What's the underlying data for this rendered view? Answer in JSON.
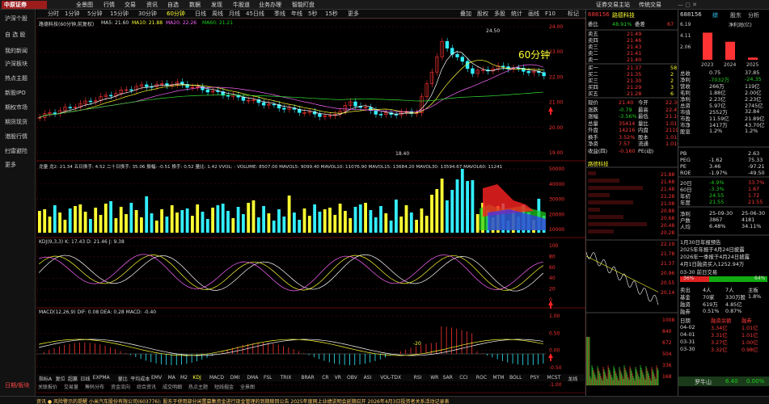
{
  "app": {
    "logo": "中原证券",
    "top_menu": [
      "全景图",
      "行情",
      "交易",
      "资讯",
      "自选",
      "数据",
      "发现",
      "牛股道",
      "业务办理",
      "智能盯盘"
    ],
    "top_right": [
      "证券交易主站",
      "传统交易"
    ]
  },
  "sidebar": [
    "沪深个股",
    "自 选 股",
    "我的新闻",
    "沪深板块",
    "热点主题",
    "新股IPO",
    "期权市场",
    "期货现货",
    "港股行情",
    "扫雷避险",
    "更多",
    "日期/板块"
  ],
  "tabs": [
    "分时",
    "1分钟",
    "5分钟",
    "15分钟",
    "30分钟",
    "60分钟",
    "日线",
    "周线",
    "月线",
    "45日线",
    "季线",
    "年线",
    "5秒",
    "15秒",
    "更多"
  ],
  "tabs_right": [
    "叠加",
    "股权",
    "多股",
    "统计",
    "画线",
    "F10",
    "标记",
    "设置"
  ],
  "chart": {
    "title": "路德科技(60分钟,前复权)",
    "ma_label": "MA5: 21.60",
    "ma10": "MA10: 21.88",
    "ma20": "MA20: 22.26",
    "ma60": "MA60: 21.21",
    "annotation": "60分钟",
    "high": "24.50",
    "low": "18.40",
    "price_ticks": [
      "24.00",
      "23.00",
      "22.00",
      "21.00",
      "20.00",
      "19.00"
    ],
    "vol_label": "龙量  龙2: 21.34  五日换手: 4.52  二十日换手: 35.06  振幅: -0.51  换手: 0.52  量比: 1.42  VVOL: - VOLUME: 8507.00  MAVOL5: 9099.40  MAVOL10: 11076.90  MAVOL15: 13684.20  MAVOL30: 13594.67  MAVOL60: 11241",
    "vol_ticks": [
      "50000",
      "40000",
      "30000",
      "20000",
      "10000"
    ],
    "kdj_label": "KDJ(9,3,3)  K: 17.43  D: 21.46  J: 9.38",
    "kdj_ticks": [
      "100",
      "80",
      "60",
      "40",
      "20",
      "0"
    ],
    "macd_label": "MACD(12,26,9)  DIF: 0.08  DEA: 0.28  MACD: -0.40",
    "macd_ticks": [
      "1.00",
      "0.50",
      "0.00",
      "-0.50",
      "-1.00"
    ],
    "macd_note": "-20"
  },
  "indicator_tabs": [
    "指标A",
    "复位",
    "超赢",
    "日线",
    "EXPMA",
    "量比",
    "平均成本",
    "EMV",
    "MA",
    "M2",
    "KDJ",
    "MACD",
    "DMI",
    "DMA",
    "FSL",
    "TRIX",
    "BRAR",
    "CR",
    "VR",
    "OBV",
    "ASI",
    "VOL-TDX",
    "RSI",
    "WR",
    "SAR",
    "CCI",
    "ROC",
    "MTM",
    "BOLL",
    "PSY",
    "MCST",
    "龙线",
    "龙尾"
  ],
  "bottom_tabs": [
    "关联报价",
    "交易量",
    "筹码分布",
    "资金流向",
    "综合资讯",
    "成交明细",
    "热点主题",
    "短线掘金",
    "全景图"
  ],
  "rp": {
    "code": "688156",
    "name": "路德科技",
    "wb": "48.91%",
    "wc": "67",
    "asks": [
      [
        "卖五",
        "21.49",
        ""
      ],
      [
        "卖四",
        "21.46",
        ""
      ],
      [
        "卖三",
        "21.43",
        ""
      ],
      [
        "卖二",
        "21.41",
        ""
      ],
      [
        "卖一",
        "21.40",
        ""
      ]
    ],
    "bids": [
      [
        "买一",
        "21.37",
        "58"
      ],
      [
        "买二",
        "21.35",
        "2"
      ],
      [
        "买三",
        "21.30",
        "2"
      ],
      [
        "买四",
        "21.29",
        "3"
      ],
      [
        "买五",
        "21.28",
        "6"
      ]
    ],
    "quotes": [
      [
        "现价",
        "21.40",
        "今开",
        "22.30"
      ],
      [
        "涨跌",
        "-0.79",
        "最高",
        "22.47"
      ],
      [
        "涨幅",
        "-3.56%",
        "最低",
        "21.10"
      ],
      [
        "总量",
        "35414",
        "量比",
        "1.01"
      ],
      [
        "外盘",
        "14216",
        "内盘",
        "21198"
      ],
      [
        "换手",
        "3.52%",
        "股本",
        "1.01亿"
      ],
      [
        "净资",
        "7.57",
        "流通",
        "1.01亿"
      ],
      [
        "收益(四)",
        "-0.160",
        "PE(动)",
        ""
      ]
    ],
    "mini_ticks": [
      "22.19",
      "21.78",
      "21.37",
      "20.96",
      "20.55",
      "20.14"
    ],
    "tick_list": [
      "21.88",
      "21.68",
      "21.48",
      "21.28",
      "21.08",
      "20.88",
      "20.68",
      "20.48",
      "20.28"
    ],
    "mini2_ticks": [
      "22.19",
      "21.37",
      "21.57",
      "21.37",
      "21.56",
      "21.76"
    ],
    "bars2_ticks": [
      "1008",
      "840",
      "672",
      "504",
      "336",
      "168"
    ]
  },
  "fp": {
    "code": "688156",
    "tabs": [
      "综",
      "股东",
      "分析"
    ],
    "chart_title": "净利润(亿)",
    "chart_data": {
      "type": "bar",
      "categories": [
        "2023",
        "2024",
        "2025"
      ],
      "series": [
        {
          "name": "",
          "values": [
            6.19,
            4.11,
            0.51
          ]
        }
      ]
    },
    "y_ticks": [
      "6.19",
      "4.11",
      "2.06"
    ],
    "rows": [
      [
        "总收",
        "0.75",
        "37.85"
      ],
      [
        "净利",
        "-7032万",
        "-24.35"
      ],
      [
        "营收",
        "266万",
        "119亿"
      ],
      [
        "毛利",
        "1.88亿",
        "2.00亿"
      ],
      [
        "净利",
        "2.23亿",
        "2.23亿"
      ],
      [
        "总资",
        "5.97亿",
        "2745亿"
      ],
      [
        "市值",
        "2552万",
        "32.84"
      ],
      [
        "市盈",
        "11.59亿",
        "21.89亿"
      ],
      [
        "市净",
        "1417万",
        "43.70亿"
      ],
      [
        "股息",
        "1.2%",
        "1.2%"
      ]
    ],
    "ratios": [
      [
        "PB",
        "",
        "2.63"
      ],
      [
        "PEG",
        "-1.62",
        "75.33"
      ],
      [
        "PE",
        "3.46",
        "-97.21"
      ],
      [
        "ROE",
        "-1.97%",
        "-49.50"
      ]
    ],
    "period": [
      [
        "20日",
        "-4.9%",
        "33.7%"
      ],
      [
        "60日",
        "-3.3%",
        "1.67"
      ],
      [
        "年初",
        "24.55",
        "1.72"
      ],
      [
        "年度",
        "21.55",
        "21.55"
      ]
    ],
    "dates": [
      [
        "净利",
        "25-09-30",
        "25-06-30"
      ],
      [
        "户数",
        "3867",
        "4181"
      ],
      [
        "人均",
        "6.48%",
        "34.11%"
      ]
    ],
    "notes": [
      "1月30日年报预告",
      "2025年年报于4月24日披露",
      "2026年一季报于4月24日披露",
      "4月1日融资买入1252.94万"
    ],
    "ma_notes": "03-30 前日交易",
    "buy_pct": "36%",
    "sell_pct": "64%",
    "flow": [
      [
        "卖出",
        "4人",
        "7人",
        "主板"
      ],
      [
        "基金",
        "70家",
        "330万股",
        "1.8%"
      ],
      [
        "融资",
        "619万",
        "4.85亿"
      ],
      [
        "融券",
        "0.51%",
        "0.87%"
      ]
    ],
    "margin": [
      [
        "日期",
        "融资余额",
        "融券"
      ],
      [
        "04-02",
        "3.34亿",
        "1.01亿"
      ],
      [
        "04-01",
        "3.31亿",
        "1.01亿"
      ],
      [
        "03-31",
        "3.27亿",
        "1.00亿"
      ],
      [
        "03-30",
        "3.32亿",
        "0.98亿"
      ]
    ],
    "bottom_name": "罗牛山",
    "bottom_price": "6.40",
    "bottom_pct": "0.00%"
  },
  "status": "资讯   ● 风险警示的提醒   小米汽车股份有限公司(603776): 股东于使用部分闲置募集资金进行现金管理的到期赎回公告  2025年度网上业绩说明会延期召开  2026年4月3日投资者关系活动记录表"
}
